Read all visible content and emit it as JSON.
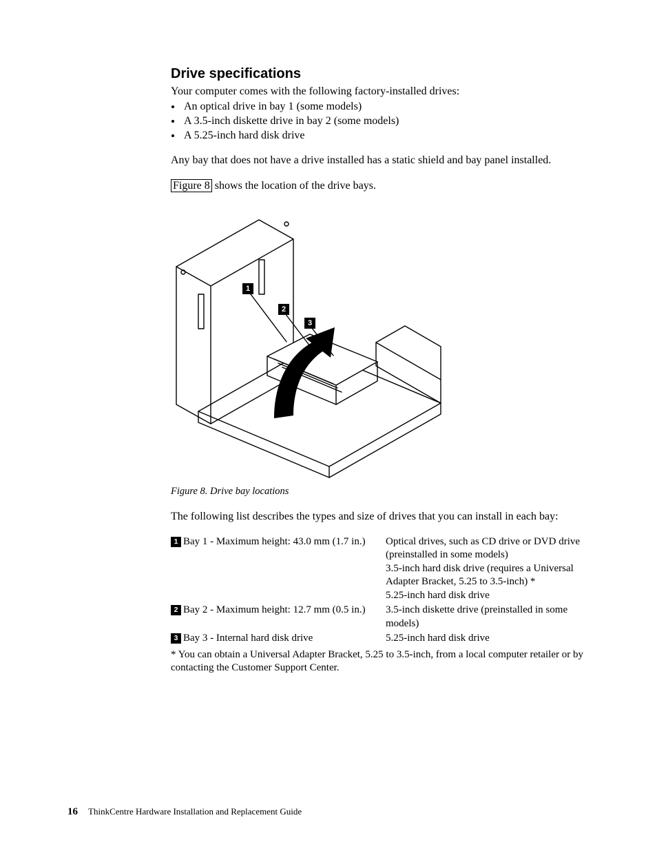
{
  "heading": "Drive specifications",
  "lead": "Your computer comes with the following factory-installed drives:",
  "bullets": [
    "An optical drive in bay 1 (some models)",
    "A 3.5-inch diskette drive in bay 2 (some models)",
    "A 5.25-inch hard disk drive"
  ],
  "para1": "Any bay that does not have a drive installed has a static shield and bay panel installed.",
  "figref_label": "Figure 8",
  "figref_tail": " shows the location of the drive bays.",
  "callouts": {
    "c1": "1",
    "c2": "2",
    "c3": "3"
  },
  "fig_caption": "Figure 8. Drive bay locations",
  "para2": "The following list describes the types and size of drives that you can install in each bay:",
  "table": {
    "rows": [
      {
        "num": "1",
        "label": "Bay 1 - Maximum height: 43.0 mm (1.7 in.)",
        "desc": "Optical drives, such as CD drive or DVD drive (preinstalled in some models)\n3.5-inch hard disk drive (requires a Universal Adapter Bracket, 5.25 to 3.5-inch) *\n5.25-inch hard disk drive"
      },
      {
        "num": "2",
        "label": "Bay 2 - Maximum height: 12.7 mm (0.5 in.)",
        "desc": "3.5-inch diskette drive (preinstalled in some models)"
      },
      {
        "num": "3",
        "label": "Bay 3 - Internal hard disk drive",
        "desc": "5.25-inch hard disk drive"
      }
    ]
  },
  "footnote": "* You can obtain a Universal Adapter Bracket, 5.25 to 3.5-inch, from a local computer retailer or by contacting the Customer Support Center.",
  "footer": {
    "page": "16",
    "title": "ThinkCentre Hardware Installation and Replacement Guide"
  }
}
